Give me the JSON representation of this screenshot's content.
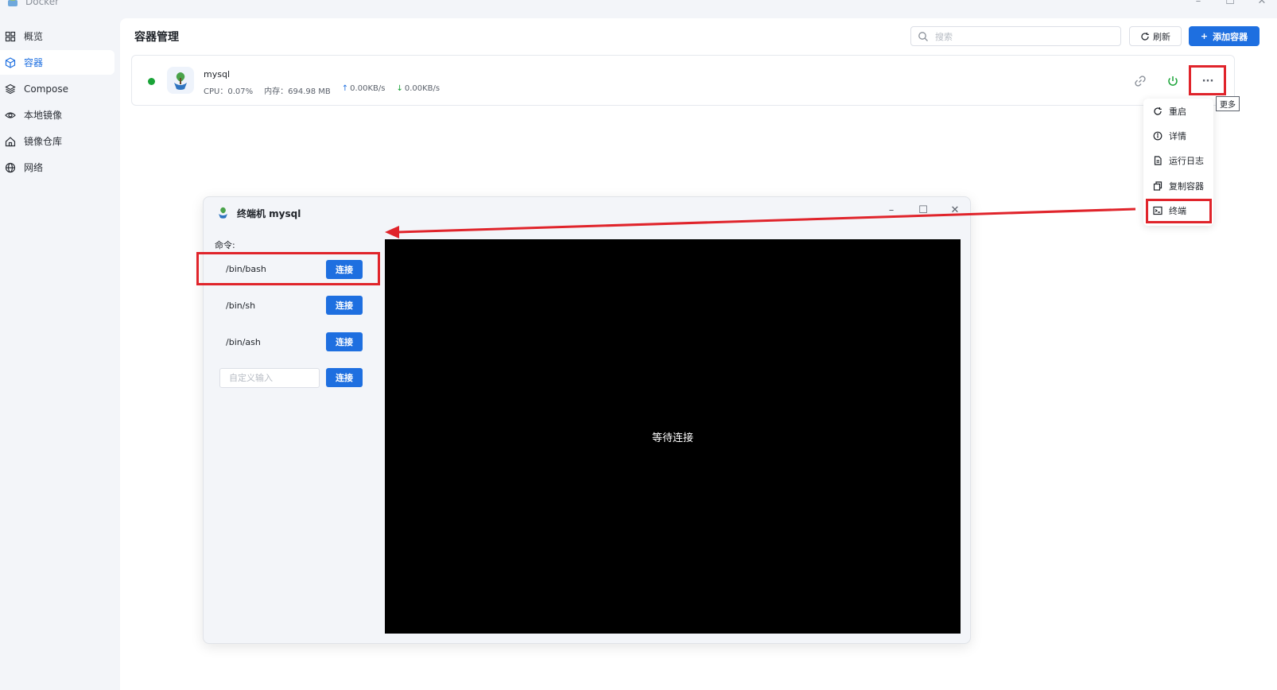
{
  "app": {
    "title": "Docker"
  },
  "sidebar": {
    "items": [
      {
        "label": "概览",
        "icon": "grid-icon"
      },
      {
        "label": "容器",
        "icon": "cube-icon",
        "active": true
      },
      {
        "label": "Compose",
        "icon": "layers-icon"
      },
      {
        "label": "本地镜像",
        "icon": "eye-icon"
      },
      {
        "label": "镜像仓库",
        "icon": "home-icon"
      },
      {
        "label": "网络",
        "icon": "globe-icon"
      }
    ]
  },
  "header": {
    "title": "容器管理",
    "search_placeholder": "搜索",
    "refresh_label": "刷新",
    "add_label": "添加容器"
  },
  "container": {
    "name": "mysql",
    "status": "running",
    "cpu": "CPU：0.07%",
    "memory": "内存：694.98 MB",
    "upload": "0.00KB/s",
    "download": "0.00KB/s",
    "more_tooltip": "更多"
  },
  "menu": {
    "items": [
      {
        "label": "重启",
        "icon": "restart-icon"
      },
      {
        "label": "详情",
        "icon": "info-icon"
      },
      {
        "label": "运行日志",
        "icon": "log-icon"
      },
      {
        "label": "复制容器",
        "icon": "copy-icon"
      },
      {
        "label": "终端",
        "icon": "terminal-icon"
      }
    ]
  },
  "terminal_dialog": {
    "title": "终端机 mysql",
    "command_label": "命令:",
    "commands": [
      {
        "label": "/bin/bash",
        "button": "连接"
      },
      {
        "label": "/bin/sh",
        "button": "连接"
      },
      {
        "label": "/bin/ash",
        "button": "连接"
      }
    ],
    "custom_placeholder": "自定义输入",
    "custom_button": "连接",
    "status_text": "等待连接"
  },
  "colors": {
    "accent": "#1e6fe0",
    "status_running": "#19a337",
    "annotation_red": "#e0242b",
    "terminal_bg": "#000000"
  }
}
